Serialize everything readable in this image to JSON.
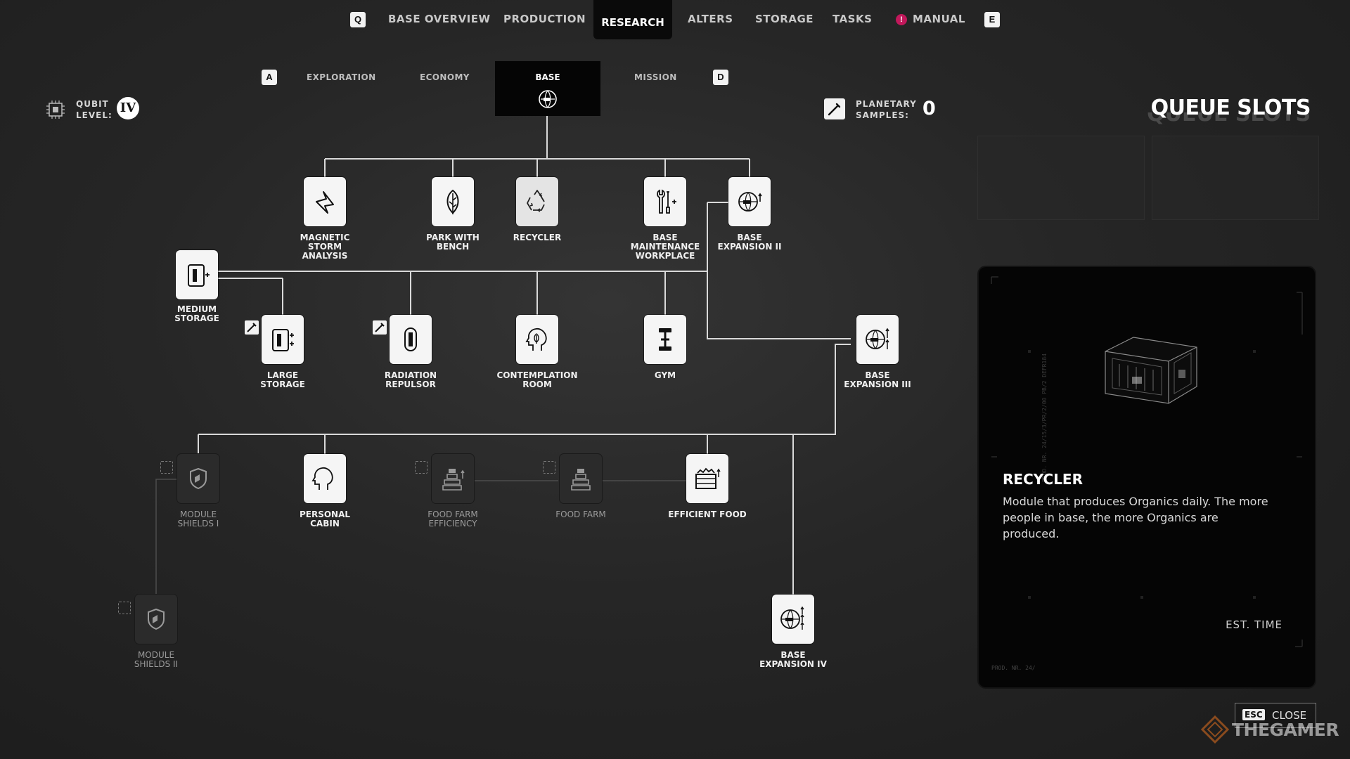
{
  "nav": {
    "key_left": "Q",
    "key_right": "E",
    "tabs": [
      "BASE OVERVIEW",
      "PRODUCTION",
      "RESEARCH",
      "ALTERS",
      "STORAGE",
      "TASKS",
      "MANUAL"
    ],
    "active_tab": "RESEARCH",
    "manual_alert": "!"
  },
  "subnav": {
    "key_left": "A",
    "key_right": "D",
    "tabs": [
      "EXPLORATION",
      "ECONOMY",
      "BASE",
      "MISSION"
    ],
    "active_tab": "BASE"
  },
  "qubit": {
    "label_line1": "QUBIT",
    "label_line2": "LEVEL:",
    "level": "IV"
  },
  "samples": {
    "label_line1": "PLANETARY",
    "label_line2": "SAMPLES:",
    "count": "0"
  },
  "queue": {
    "title": "QUEUE SLOTS",
    "slot_count": 2
  },
  "tree": {
    "nodes": [
      {
        "id": "magnetic-storm-analysis",
        "lines": [
          "MAGNETIC",
          "STORM",
          "ANALYSIS"
        ],
        "icon": "bolt-burst-icon",
        "state": "unlocked"
      },
      {
        "id": "park-with-bench",
        "lines": [
          "PARK WITH",
          "BENCH"
        ],
        "icon": "leaf-icon",
        "state": "unlocked"
      },
      {
        "id": "recycler",
        "lines": [
          "RECYCLER"
        ],
        "icon": "recycle-icon",
        "state": "selected"
      },
      {
        "id": "base-maintenance-workplace",
        "lines": [
          "BASE",
          "MAINTENANCE",
          "WORKPLACE"
        ],
        "icon": "wrench-screwdriver-icon",
        "state": "unlocked"
      },
      {
        "id": "base-expansion-ii",
        "lines": [
          "BASE",
          "EXPANSION II"
        ],
        "icon": "base-expansion-icon",
        "state": "unlocked"
      },
      {
        "id": "medium-storage",
        "lines": [
          "MEDIUM",
          "STORAGE"
        ],
        "icon": "storage-icon",
        "state": "unlocked"
      },
      {
        "id": "large-storage",
        "lines": [
          "LARGE",
          "STORAGE"
        ],
        "icon": "storage-icon",
        "state": "unlocked"
      },
      {
        "id": "radiation-repulsor",
        "lines": [
          "RADIATION",
          "REPULSOR"
        ],
        "icon": "capsule-icon",
        "state": "unlocked"
      },
      {
        "id": "contemplation-room",
        "lines": [
          "CONTEMPLATION",
          "ROOM"
        ],
        "icon": "head-leaf-icon",
        "state": "unlocked"
      },
      {
        "id": "gym",
        "lines": [
          "GYM"
        ],
        "icon": "dumbbell-icon",
        "state": "unlocked"
      },
      {
        "id": "base-expansion-iii",
        "lines": [
          "BASE",
          "EXPANSION III"
        ],
        "icon": "base-expansion-icon",
        "state": "unlocked"
      },
      {
        "id": "module-shields-i",
        "lines": [
          "MODULE",
          "SHIELDS I"
        ],
        "icon": "shield-icon",
        "state": "locked"
      },
      {
        "id": "personal-cabin",
        "lines": [
          "PERSONAL",
          "CABIN"
        ],
        "icon": "head-profile-icon",
        "state": "unlocked"
      },
      {
        "id": "food-farm-efficiency",
        "lines": [
          "FOOD FARM",
          "EFFICIENCY"
        ],
        "icon": "farm-icon",
        "state": "locked"
      },
      {
        "id": "food-farm",
        "lines": [
          "FOOD FARM"
        ],
        "icon": "farm-icon",
        "state": "locked"
      },
      {
        "id": "efficient-food",
        "lines": [
          "EFFICIENT FOOD"
        ],
        "icon": "food-crate-icon",
        "state": "unlocked"
      },
      {
        "id": "module-shields-ii",
        "lines": [
          "MODULE",
          "SHIELDS II"
        ],
        "icon": "shield-icon",
        "state": "locked"
      },
      {
        "id": "base-expansion-iv",
        "lines": [
          "BASE",
          "EXPANSION IV"
        ],
        "icon": "base-expansion-icon",
        "state": "unlocked"
      }
    ]
  },
  "detail": {
    "title": "RECYCLER",
    "description": "Module that produces Organics daily. The more people in base, the more Organics are produced.",
    "est_time_label": "EST. TIME",
    "prod_text": "PROD. NR. 24/"
  },
  "close": {
    "key": "ESC",
    "label": "CLOSE"
  },
  "watermark": "THEGAMER"
}
